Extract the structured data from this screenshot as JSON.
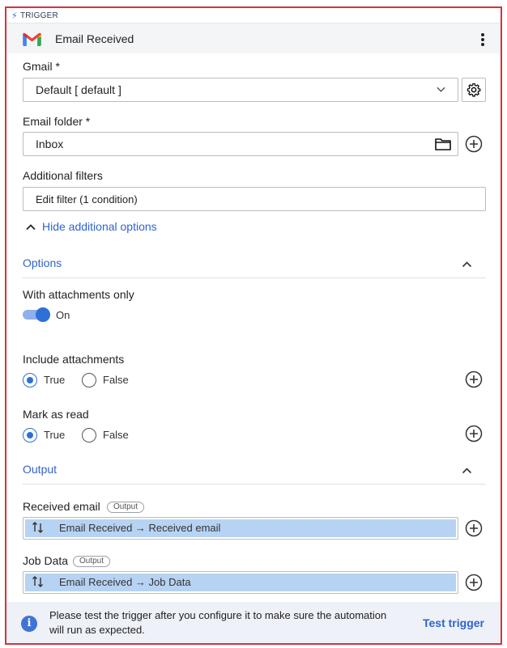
{
  "trigger_label": "TRIGGER",
  "header": {
    "title": "Email Received"
  },
  "gmail": {
    "label": "Gmail *",
    "value": "Default [ default ]"
  },
  "email_folder": {
    "label": "Email folder *",
    "value": "Inbox"
  },
  "additional_filters": {
    "label": "Additional filters",
    "value": "Edit filter (1 condition)"
  },
  "hide_options_link": "Hide additional options",
  "options": {
    "title": "Options",
    "with_attachments": {
      "label": "With attachments only",
      "state": "On",
      "checked": true
    },
    "include_attachments": {
      "label": "Include attachments",
      "true_label": "True",
      "false_label": "False",
      "selected": "True"
    },
    "mark_as_read": {
      "label": "Mark as read",
      "true_label": "True",
      "false_label": "False",
      "selected": "True"
    }
  },
  "output": {
    "title": "Output",
    "received_email": {
      "label": "Received email",
      "badge": "Output",
      "value": "Email Received → Received email"
    },
    "job_data": {
      "label": "Job Data",
      "badge": "Output",
      "value": "Email Received → Job Data"
    }
  },
  "footer": {
    "message": "Please test the trigger after you configure it to make sure the automation will run as expected.",
    "action": "Test trigger"
  },
  "colors": {
    "accent": "#2e6fd8",
    "frame_border": "#d3343c",
    "output_fill": "#b7d3f4"
  }
}
